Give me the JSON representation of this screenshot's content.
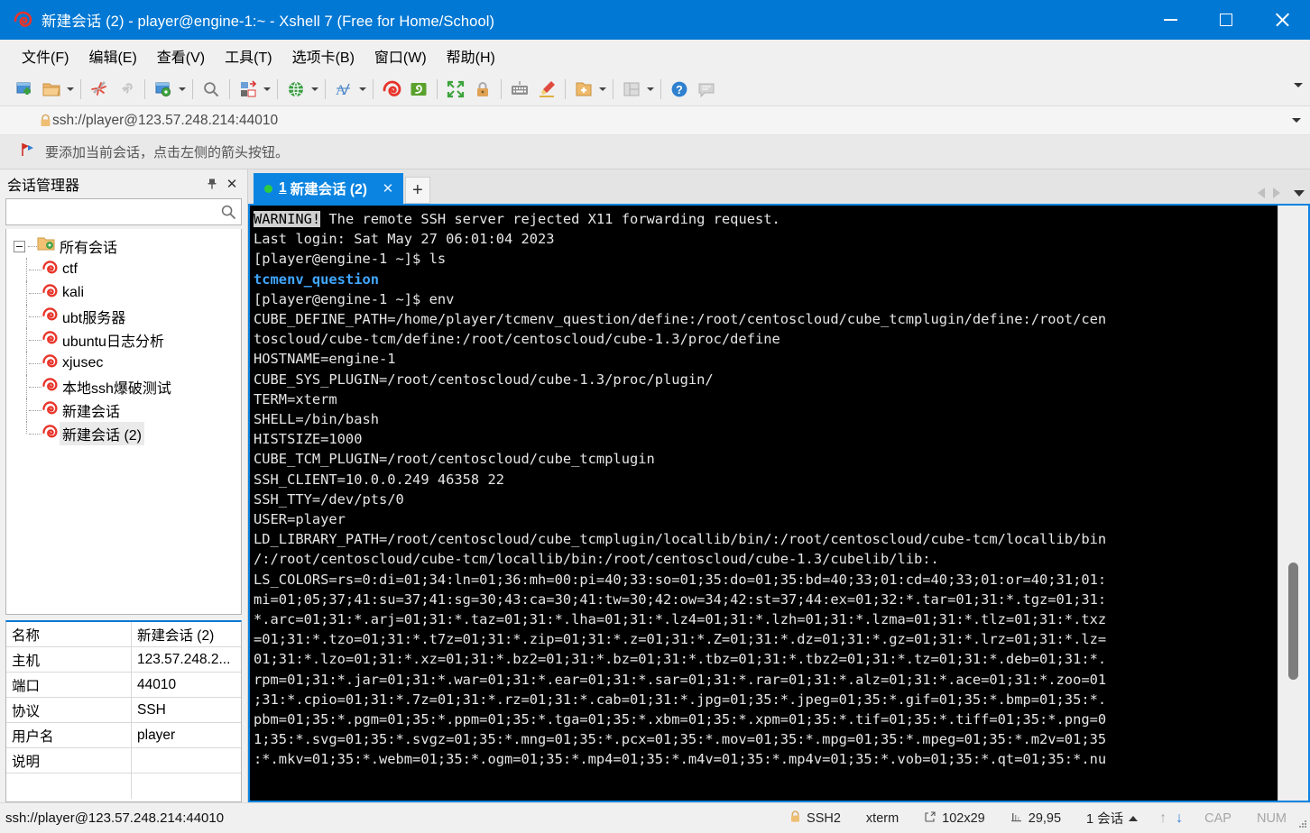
{
  "window": {
    "title": "新建会话 (2) - player@engine-1:~ - Xshell 7 (Free for Home/School)",
    "accent_color": "#0078d4",
    "minimize_label": "最小化",
    "maximize_label": "最大化",
    "close_label": "关闭"
  },
  "menu": {
    "items": [
      {
        "label": "文件(F)",
        "name": "menu-file"
      },
      {
        "label": "编辑(E)",
        "name": "menu-edit"
      },
      {
        "label": "查看(V)",
        "name": "menu-view"
      },
      {
        "label": "工具(T)",
        "name": "menu-tools"
      },
      {
        "label": "选项卡(B)",
        "name": "menu-tab"
      },
      {
        "label": "窗口(W)",
        "name": "menu-window"
      },
      {
        "label": "帮助(H)",
        "name": "menu-help"
      }
    ]
  },
  "toolbar": {
    "icons": [
      "new-session-icon",
      "open-folder-icon",
      "disconnect-icon",
      "link-icon",
      "session-properties-icon",
      "find-icon",
      "file-transfer-icon",
      "globe-icon",
      "font-icon",
      "xshell-icon",
      "xftp-icon",
      "fullscreen-icon",
      "lock-icon",
      "keyboard-icon",
      "highlight-icon",
      "add-folder-icon",
      "layout-icon",
      "help-icon",
      "chat-icon"
    ]
  },
  "address_bar": {
    "url": "ssh://player@123.57.248.214:44010",
    "icon": "lock-icon"
  },
  "hint_bar": {
    "text": "要添加当前会话，点击左侧的箭头按钮。",
    "icon": "red-flag-icon"
  },
  "sidebar": {
    "title": "会话管理器",
    "pin_label": "📌",
    "close_label": "✕",
    "search_placeholder": "",
    "search_value": "",
    "tree": {
      "root_label": "所有会话",
      "items": [
        {
          "label": "ctf",
          "selected": false
        },
        {
          "label": "kali",
          "selected": false
        },
        {
          "label": "ubt服务器",
          "selected": false
        },
        {
          "label": "ubuntu日志分析",
          "selected": false
        },
        {
          "label": "xjusec",
          "selected": false
        },
        {
          "label": "本地ssh爆破测试",
          "selected": false
        },
        {
          "label": "新建会话",
          "selected": false
        },
        {
          "label": "新建会话 (2)",
          "selected": true
        }
      ]
    },
    "properties": [
      {
        "key": "名称",
        "value": "新建会话 (2)"
      },
      {
        "key": "主机",
        "value": "123.57.248.2..."
      },
      {
        "key": "端口",
        "value": "44010"
      },
      {
        "key": "协议",
        "value": "SSH"
      },
      {
        "key": "用户名",
        "value": "player"
      },
      {
        "key": "说明",
        "value": ""
      },
      {
        "key": "",
        "value": ""
      }
    ]
  },
  "tabs": {
    "active": {
      "number": "1",
      "label": "新建会话 (2)",
      "close_label": "✕",
      "status_dot_color": "#2ecc40"
    },
    "new_tab_label": "+",
    "nav_prev": "◀",
    "nav_next": "▶"
  },
  "terminal": {
    "bg_color": "#000000",
    "fg_color": "#e6e6e6",
    "highlight_word": "WARNING!",
    "line1_rest": " The remote SSH server rejected X11 forwarding request.",
    "line2": "Last login: Sat May 27 06:01:04 2023",
    "line3": "[player@engine-1 ~]$ ls",
    "line4_blue": "tcmenv_question",
    "line5": "[player@engine-1 ~]$ env",
    "body": "CUBE_DEFINE_PATH=/home/player/tcmenv_question/define:/root/centoscloud/cube_tcmplugin/define:/root/cen\ntoscloud/cube-tcm/define:/root/centoscloud/cube-1.3/proc/define\nHOSTNAME=engine-1\nCUBE_SYS_PLUGIN=/root/centoscloud/cube-1.3/proc/plugin/\nTERM=xterm\nSHELL=/bin/bash\nHISTSIZE=1000\nCUBE_TCM_PLUGIN=/root/centoscloud/cube_tcmplugin\nSSH_CLIENT=10.0.0.249 46358 22\nSSH_TTY=/dev/pts/0\nUSER=player\nLD_LIBRARY_PATH=/root/centoscloud/cube_tcmplugin/locallib/bin/:/root/centoscloud/cube-tcm/locallib/bin\n/:/root/centoscloud/cube-tcm/locallib/bin:/root/centoscloud/cube-1.3/cubelib/lib:.\nLS_COLORS=rs=0:di=01;34:ln=01;36:mh=00:pi=40;33:so=01;35:do=01;35:bd=40;33;01:cd=40;33;01:or=40;31;01:\nmi=01;05;37;41:su=37;41:sg=30;43:ca=30;41:tw=30;42:ow=34;42:st=37;44:ex=01;32:*.tar=01;31:*.tgz=01;31:\n*.arc=01;31:*.arj=01;31:*.taz=01;31:*.lha=01;31:*.lz4=01;31:*.lzh=01;31:*.lzma=01;31:*.tlz=01;31:*.txz\n=01;31:*.tzo=01;31:*.t7z=01;31:*.zip=01;31:*.z=01;31:*.Z=01;31:*.dz=01;31:*.gz=01;31:*.lrz=01;31:*.lz=\n01;31:*.lzo=01;31:*.xz=01;31:*.bz2=01;31:*.bz=01;31:*.tbz=01;31:*.tbz2=01;31:*.tz=01;31:*.deb=01;31:*.\nrpm=01;31:*.jar=01;31:*.war=01;31:*.ear=01;31:*.sar=01;31:*.rar=01;31:*.alz=01;31:*.ace=01;31:*.zoo=01\n;31:*.cpio=01;31:*.7z=01;31:*.rz=01;31:*.cab=01;31:*.jpg=01;35:*.jpeg=01;35:*.gif=01;35:*.bmp=01;35:*.\npbm=01;35:*.pgm=01;35:*.ppm=01;35:*.tga=01;35:*.xbm=01;35:*.xpm=01;35:*.tif=01;35:*.tiff=01;35:*.png=0\n1;35:*.svg=01;35:*.svgz=01;35:*.mng=01;35:*.pcx=01;35:*.mov=01;35:*.mpg=01;35:*.mpeg=01;35:*.m2v=01;35\n:*.mkv=01;35:*.webm=01;35:*.ogm=01;35:*.mp4=01;35:*.m4v=01;35:*.mp4v=01;35:*.vob=01;35:*.qt=01;35:*.nu"
  },
  "statusbar": {
    "connection": "ssh://player@123.57.248.214:44010",
    "protocol": "SSH2",
    "terminal_type": "xterm",
    "size": "102x29",
    "cursor": "29,95",
    "sessions": "1 会话",
    "cap": "CAP",
    "num": "NUM",
    "lock_icon": "lock-icon",
    "size_icon": "resize-icon",
    "cursor_icon": "cursor-icon",
    "up_arrow": "↑",
    "down_arrow": "↓"
  }
}
